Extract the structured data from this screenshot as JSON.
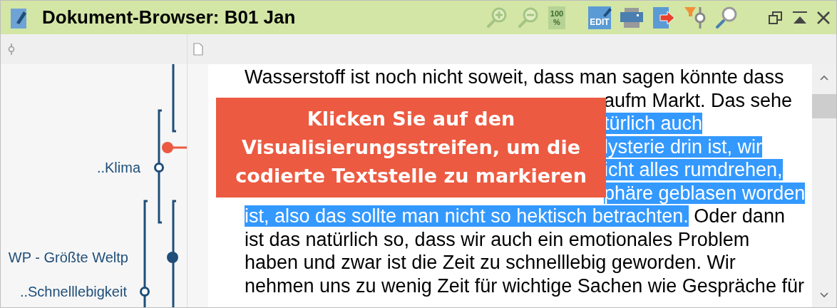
{
  "window": {
    "title": "Dokument-Browser: B01 Jan"
  },
  "toolbar": [
    {
      "kind": "zoom-in",
      "disabled": true
    },
    {
      "kind": "zoom-out",
      "disabled": true
    },
    {
      "kind": "zoom-100",
      "label": "100\n%",
      "disabled": true
    },
    {
      "kind": "edit",
      "label": "EDIT",
      "disabled": false
    },
    {
      "kind": "print",
      "disabled": false
    },
    {
      "kind": "export",
      "disabled": false
    },
    {
      "kind": "filter",
      "disabled": false
    },
    {
      "kind": "search",
      "disabled": false
    }
  ],
  "codes": [
    {
      "label": "..Klima",
      "kind": "hollow"
    },
    {
      "label": "WP - Größte Weltp",
      "kind": "filled"
    },
    {
      "label": "..Schnelllebigkeit",
      "kind": "hollow"
    }
  ],
  "callout": {
    "text": "Klicken Sie auf den Visualisierungsstreifen, um die codierte Textstelle zu markieren"
  },
  "lines": [
    {
      "covered": false,
      "segments": [
        {
          "text": "Wasserstoff ist noch nicht soweit, dass man sagen könnte dass",
          "selected": false
        }
      ]
    },
    {
      "covered": true,
      "segments": [
        {
          "text": "aufm Markt. Das sehe",
          "selected": false
        }
      ]
    },
    {
      "covered": true,
      "segments": [
        {
          "text": "türlich auch",
          "selected": true
        }
      ]
    },
    {
      "covered": true,
      "segments": [
        {
          "text": "lysterie drin ist, wir",
          "selected": true
        }
      ]
    },
    {
      "covered": true,
      "segments": [
        {
          "text": "icht alles rumdrehen,",
          "selected": true
        }
      ]
    },
    {
      "covered": true,
      "segments": [
        {
          "text": "phäre geblasen worden",
          "selected": true
        }
      ]
    },
    {
      "covered": false,
      "segments": [
        {
          "text": "ist, also das sollte man nicht so hektisch betrachten.",
          "selected": true
        },
        {
          "text": " Oder dann",
          "selected": false
        }
      ]
    },
    {
      "covered": false,
      "segments": [
        {
          "text": "ist das natürlich so, dass wir auch ein emotionales Problem",
          "selected": false
        }
      ]
    },
    {
      "covered": false,
      "segments": [
        {
          "text": "haben und zwar ist die Zeit zu schnelllebig geworden. Wir",
          "selected": false
        }
      ]
    },
    {
      "covered": false,
      "segments": [
        {
          "text": "nehmen uns zu wenig Zeit für wichtige Sachen wie Gespräche für",
          "selected": false
        }
      ]
    }
  ]
}
